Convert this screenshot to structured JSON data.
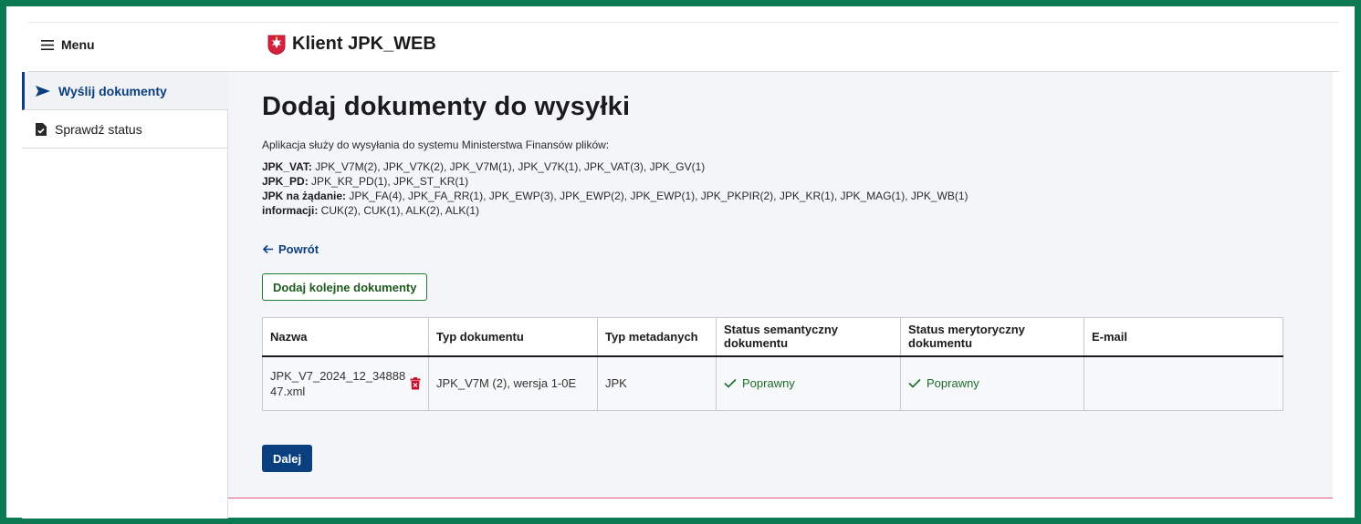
{
  "header": {
    "menu_label": "Menu",
    "app_title": "Klient JPK_WEB"
  },
  "sidebar": {
    "items": [
      {
        "label": "Wyślij dokumenty",
        "icon": "send-icon",
        "active": true
      },
      {
        "label": "Sprawdź status",
        "icon": "file-check-icon",
        "active": false
      }
    ]
  },
  "main": {
    "title": "Dodaj dokumenty do wysyłki",
    "intro": "Aplikacja służy do wysyłania do systemu Ministerstwa Finansów plików:",
    "lines": [
      {
        "label": "JPK_VAT:",
        "text": " JPK_V7M(2), JPK_V7K(2), JPK_V7M(1), JPK_V7K(1), JPK_VAT(3), JPK_GV(1)"
      },
      {
        "label": "JPK_PD:",
        "text": " JPK_KR_PD(1), JPK_ST_KR(1)"
      },
      {
        "label": "JPK na żądanie:",
        "text": " JPK_FA(4), JPK_FA_RR(1), JPK_EWP(3), JPK_EWP(2), JPK_EWP(1), JPK_PKPIR(2), JPK_KR(1), JPK_MAG(1), JPK_WB(1)"
      },
      {
        "label": "informacji:",
        "text": " CUK(2), CUK(1), ALK(2), ALK(1)"
      }
    ],
    "back_label": "Powrót",
    "add_button": "Dodaj kolejne dokumenty",
    "next_button": "Dalej"
  },
  "table": {
    "headers": {
      "name": "Nazwa",
      "doc_type": "Typ dokumentu",
      "meta_type": "Typ metadanych",
      "semantic_status": "Status semantyczny dokumentu",
      "merit_status": "Status merytoryczny dokumentu",
      "email": "E-mail"
    },
    "rows": [
      {
        "name": "JPK_V7_2024_12_3488847.xml",
        "doc_type": "JPK_V7M (2), wersja 1-0E",
        "meta_type": "JPK",
        "semantic_status": "Poprawny",
        "merit_status": "Poprawny",
        "email": ""
      }
    ]
  },
  "colors": {
    "primary": "#0a3f7f",
    "success": "#1e6a2e",
    "danger": "#c8102e",
    "frame": "#0b7a52"
  }
}
